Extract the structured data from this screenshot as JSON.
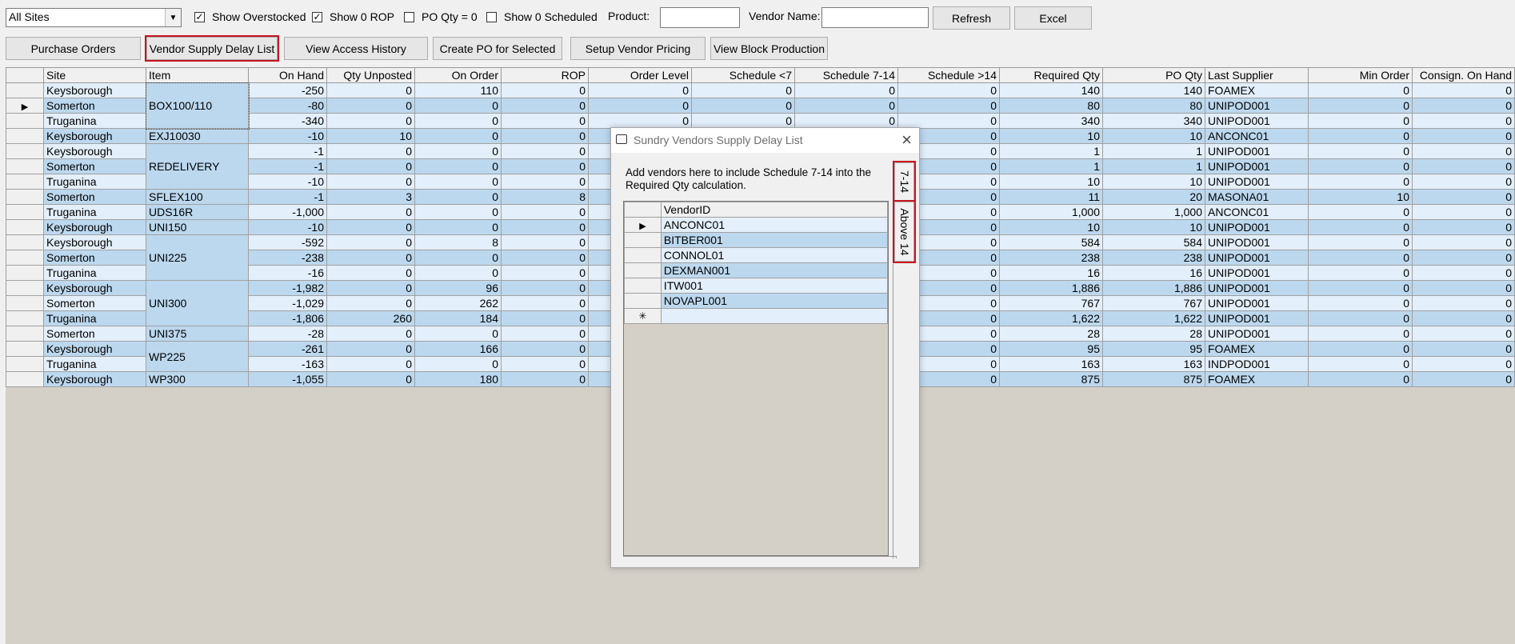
{
  "toolbar": {
    "site_select": "All Sites",
    "show_overstocked": "Show Overstocked",
    "show_zero_rop": "Show 0 ROP",
    "po_qty_zero": "PO Qty = 0",
    "show_zero_scheduled": "Show 0 Scheduled",
    "product_label": "Product:",
    "product_value": "",
    "vendor_label": "Vendor Name:",
    "vendor_value": "",
    "refresh": "Refresh",
    "excel": "Excel",
    "checks": {
      "show_overstocked": true,
      "show_zero_rop": true,
      "po_qty_zero": false,
      "show_zero_scheduled": false
    }
  },
  "actions": {
    "purchase_orders": "Purchase Orders",
    "vendor_supply_delay_list": "Vendor Supply Delay List",
    "view_access_history": "View Access History",
    "create_po_for_selected": "Create PO for Selected",
    "setup_vendor_pricing": "Setup Vendor Pricing",
    "view_block_production": "View Block Production"
  },
  "grid": {
    "columns": [
      "Site",
      "Item",
      "On Hand",
      "Qty Unposted",
      "On Order",
      "ROP",
      "Order Level",
      "Schedule <7",
      "Schedule 7-14",
      "Schedule >14",
      "Required Qty",
      "PO Qty",
      "Last Supplier",
      "Min Order",
      "Consign. On Hand"
    ],
    "rows": [
      [
        "Keysborough",
        "",
        "-250",
        "0",
        "110",
        "0",
        "0",
        "0",
        "0",
        "0",
        "140",
        "140",
        "FOAMEX",
        "0",
        "0"
      ],
      [
        "Somerton",
        "",
        "-80",
        "0",
        "0",
        "0",
        "0",
        "0",
        "0",
        "0",
        "80",
        "80",
        "UNIPOD001",
        "0",
        "0"
      ],
      [
        "Truganina",
        "",
        "-340",
        "0",
        "0",
        "0",
        "0",
        "0",
        "0",
        "0",
        "340",
        "340",
        "UNIPOD001",
        "0",
        "0"
      ],
      [
        "Keysborough",
        "EXJ10030",
        "-10",
        "10",
        "0",
        "0",
        "",
        "",
        "",
        "0",
        "10",
        "10",
        "ANCONC01",
        "0",
        "0"
      ],
      [
        "Keysborough",
        "",
        "-1",
        "0",
        "0",
        "0",
        "",
        "",
        "",
        "0",
        "1",
        "1",
        "UNIPOD001",
        "0",
        "0"
      ],
      [
        "Somerton",
        "",
        "-1",
        "0",
        "0",
        "0",
        "",
        "",
        "",
        "0",
        "1",
        "1",
        "UNIPOD001",
        "0",
        "0"
      ],
      [
        "Truganina",
        "",
        "-10",
        "0",
        "0",
        "0",
        "",
        "",
        "",
        "0",
        "10",
        "10",
        "UNIPOD001",
        "0",
        "0"
      ],
      [
        "Somerton",
        "SFLEX100",
        "-1",
        "3",
        "0",
        "8",
        "",
        "",
        "",
        "0",
        "11",
        "20",
        "MASONA01",
        "10",
        "0"
      ],
      [
        "Truganina",
        "UDS16R",
        "-1,000",
        "0",
        "0",
        "0",
        "",
        "",
        "",
        "0",
        "1,000",
        "1,000",
        "ANCONC01",
        "0",
        "0"
      ],
      [
        "Keysborough",
        "UNI150",
        "-10",
        "0",
        "0",
        "0",
        "",
        "",
        "",
        "0",
        "10",
        "10",
        "UNIPOD001",
        "0",
        "0"
      ],
      [
        "Keysborough",
        "",
        "-592",
        "0",
        "8",
        "0",
        "",
        "",
        "",
        "0",
        "584",
        "584",
        "UNIPOD001",
        "0",
        "0"
      ],
      [
        "Somerton",
        "",
        "-238",
        "0",
        "0",
        "0",
        "",
        "",
        "",
        "0",
        "238",
        "238",
        "UNIPOD001",
        "0",
        "0"
      ],
      [
        "Truganina",
        "",
        "-16",
        "0",
        "0",
        "0",
        "",
        "",
        "",
        "0",
        "16",
        "16",
        "UNIPOD001",
        "0",
        "0"
      ],
      [
        "Keysborough",
        "",
        "-1,982",
        "0",
        "96",
        "0",
        "",
        "",
        "",
        "0",
        "1,886",
        "1,886",
        "UNIPOD001",
        "0",
        "0"
      ],
      [
        "Somerton",
        "",
        "-1,029",
        "0",
        "262",
        "0",
        "",
        "",
        "",
        "0",
        "767",
        "767",
        "UNIPOD001",
        "0",
        "0"
      ],
      [
        "Truganina",
        "",
        "-1,806",
        "260",
        "184",
        "0",
        "",
        "",
        "",
        "0",
        "1,622",
        "1,622",
        "UNIPOD001",
        "0",
        "0"
      ],
      [
        "Somerton",
        "UNI375",
        "-28",
        "0",
        "0",
        "0",
        "",
        "",
        "",
        "0",
        "28",
        "28",
        "UNIPOD001",
        "0",
        "0"
      ],
      [
        "Keysborough",
        "",
        "-261",
        "0",
        "166",
        "0",
        "",
        "",
        "",
        "0",
        "95",
        "95",
        "FOAMEX",
        "0",
        "0"
      ],
      [
        "Truganina",
        "",
        "-163",
        "0",
        "0",
        "0",
        "",
        "",
        "",
        "0",
        "163",
        "163",
        "INDPOD001",
        "0",
        "0"
      ],
      [
        "Keysborough",
        "WP300",
        "-1,055",
        "0",
        "180",
        "0",
        "",
        "",
        "",
        "0",
        "875",
        "875",
        "FOAMEX",
        "0",
        "0"
      ]
    ],
    "merged_items": [
      {
        "start": 0,
        "span": 3,
        "label": "BOX100/110"
      },
      {
        "start": 4,
        "span": 3,
        "label": "REDELIVERY"
      },
      {
        "start": 10,
        "span": 3,
        "label": "UNI225"
      },
      {
        "start": 13,
        "span": 3,
        "label": "UNI300"
      },
      {
        "start": 17,
        "span": 2,
        "label": "WP225"
      }
    ],
    "current_row": 1
  },
  "dialog": {
    "title": "Sundry Vendors Supply Delay List",
    "description": "Add vendors here to include Schedule 7-14 into the Required Qty calculation.",
    "column": "VendorID",
    "vendors": [
      "ANCONC01",
      "BITBER001",
      "CONNOL01",
      "DEXMAN001",
      "ITW001",
      "NOVAPL001"
    ],
    "current_row": 0,
    "tabs": [
      "7-14",
      "Above 14"
    ]
  }
}
